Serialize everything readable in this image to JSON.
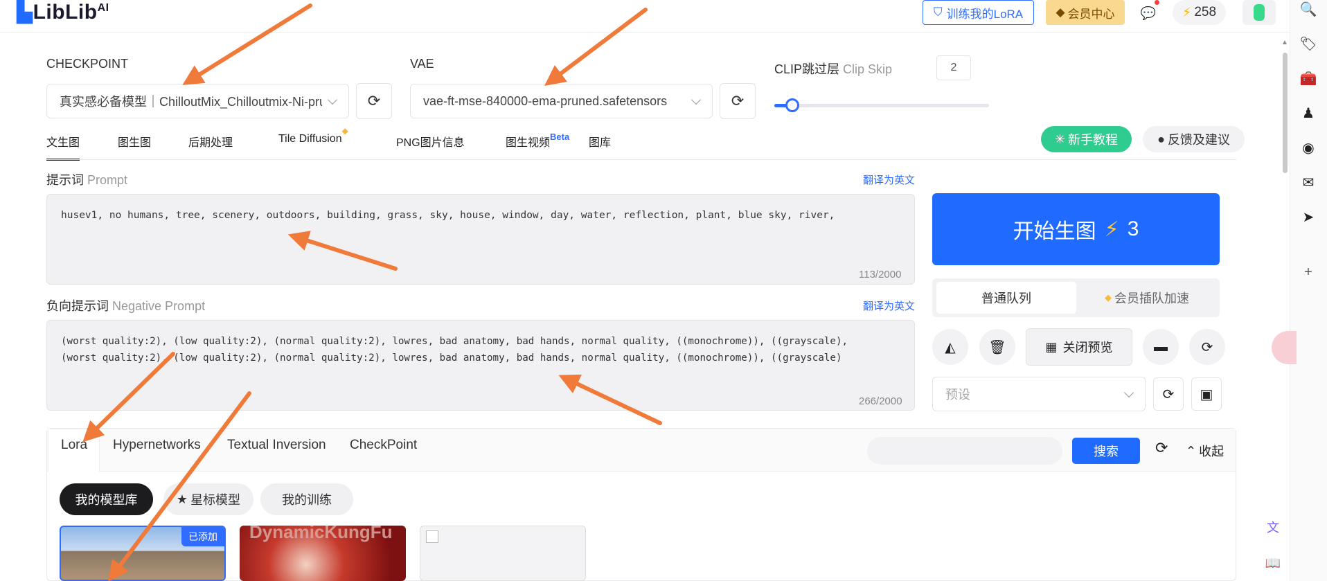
{
  "header": {
    "logo_main": "LibLib",
    "logo_ai": "AI",
    "train_lora": "训练我的LoRA",
    "vip_center": "会员中心",
    "credits": "258"
  },
  "model_select": {
    "checkpoint_label": "CHECKPOINT",
    "checkpoint_value": "真实感必备模型｜ChilloutMix_Chilloutmix-Ni-prun",
    "vae_label": "VAE",
    "vae_value": "vae-ft-mse-840000-ema-pruned.safetensors",
    "clip_label_cn": "CLIP跳过层",
    "clip_label_en": "Clip Skip",
    "clip_value": "2",
    "clip_slider_fraction": 0.08
  },
  "tabs": [
    {
      "label": "文生图",
      "active": true
    },
    {
      "label": "图生图"
    },
    {
      "label": "后期处理"
    },
    {
      "label": "Tile Diffusion"
    },
    {
      "label": "PNG图片信息"
    },
    {
      "label": "图生视频",
      "badge": "Beta"
    },
    {
      "label": "图库"
    }
  ],
  "guide_btn": "新手教程",
  "feedback_btn": "反馈及建议",
  "prompt": {
    "label_cn": "提示词",
    "label_en": "Prompt",
    "translate": "翻译为英文",
    "text": "husev1, no humans, tree, scenery, outdoors, building, grass, sky, house, window, day, water, reflection, plant, blue sky, river,",
    "counter": "113/2000"
  },
  "negative_prompt": {
    "label_cn": "负向提示词",
    "label_en": "Negative Prompt",
    "translate": "翻译为英文",
    "line1": "(worst quality:2), (low quality:2), (normal quality:2), lowres, bad anatomy, bad hands, normal quality, ((monochrome)), ((grayscale),",
    "line2": "(worst quality:2), (low quality:2), (normal quality:2), lowres, bad anatomy, bad hands, normal quality, ((monochrome)), ((grayscale)",
    "counter": "266/2000"
  },
  "generate": {
    "label": "开始生图",
    "cost": "3"
  },
  "queue": {
    "normal": "普通队列",
    "vip": "会员插队加速"
  },
  "close_preview": "关闭预览",
  "preset_placeholder": "预设",
  "model_panel": {
    "tabs": [
      "Lora",
      "Hypernetworks",
      "Textual Inversion",
      "CheckPoint"
    ],
    "search_btn": "搜索",
    "collapse": "收起",
    "filters": [
      "我的模型库",
      "星标模型",
      "我的训练"
    ],
    "card1_badge": "已添加",
    "card2_text": "DynamicKungFu"
  },
  "colors": {
    "accent": "#1f6bff",
    "guide_green": "#2ecc8f",
    "vip_gold": "#f8d98f",
    "annotation_arrow": "#f07a3a"
  }
}
